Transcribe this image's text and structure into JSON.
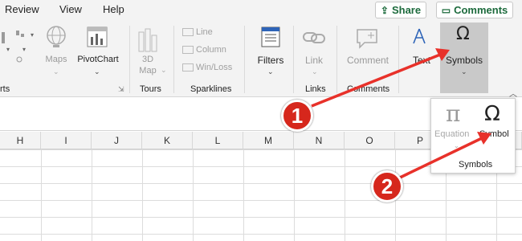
{
  "menu": {
    "items": [
      "Review",
      "View",
      "Help"
    ],
    "share_label": "Share",
    "comments_label": "Comments"
  },
  "ribbon": {
    "maps_label": "Maps",
    "pivotchart_label": "PivotChart",
    "map3d_label_line1": "3D",
    "map3d_label_line2": "Map",
    "sparkline_line": "Line",
    "sparkline_column": "Column",
    "sparkline_winloss": "Win/Loss",
    "filters_label": "Filters",
    "link_label": "Link",
    "comment_label": "Comment",
    "text_label": "Text",
    "symbols_label": "Symbols",
    "groups": {
      "charts_partial": "rts",
      "tours": "Tours",
      "sparklines": "Sparklines",
      "links": "Links",
      "comments": "Comments"
    }
  },
  "popup": {
    "equation_label": "Equation",
    "symbol_label": "Symbol",
    "group_label": "Symbols"
  },
  "columns": [
    "H",
    "I",
    "J",
    "K",
    "L",
    "M",
    "N",
    "O",
    "P"
  ],
  "callouts": {
    "one": "1",
    "two": "2"
  },
  "colors": {
    "accent_green": "#1d6b3d",
    "badge_red": "#d6271c",
    "arrow_red": "#e8312a",
    "selected_button": "#c9c9c9"
  }
}
